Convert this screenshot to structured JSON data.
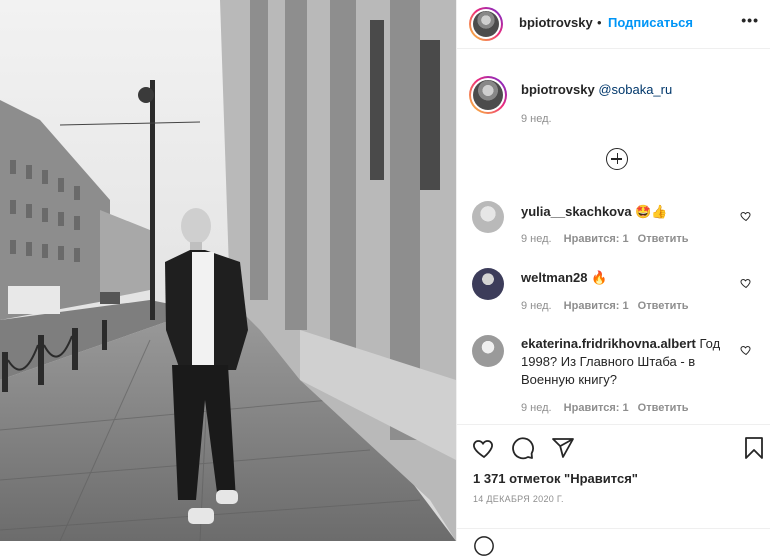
{
  "header": {
    "username": "bpiotrovsky",
    "separator": "•",
    "follow_label": "Подписаться",
    "more_icon": "more-options-icon"
  },
  "caption": {
    "username": "bpiotrovsky",
    "mention": "@sobaka_ru",
    "time": "9 нед."
  },
  "load_more_icon": "plus-circle-icon",
  "comments": [
    {
      "username": "yulia__skachkova",
      "text": "🤩👍",
      "time": "9 нед.",
      "likes": "Нравится: 1",
      "reply": "Ответить"
    },
    {
      "username": "weltman28",
      "text": "🔥",
      "time": "9 нед.",
      "likes": "Нравится: 1",
      "reply": "Ответить"
    },
    {
      "username": "ekaterina.fridrikhovna.albert",
      "text": "Год 1998? Из Главного Штаба - в Военную книгу?",
      "time": "9 нед.",
      "likes": "Нравится: 1",
      "reply": "Ответить"
    }
  ],
  "actions": {
    "likes_text": "1 371 отметок \"Нравится\"",
    "date": "14 ДЕКАБРЯ 2020 Г."
  },
  "colors": {
    "accent": "#0095f6",
    "text": "#262626",
    "muted": "#8e8e8e",
    "border": "#efefef"
  }
}
